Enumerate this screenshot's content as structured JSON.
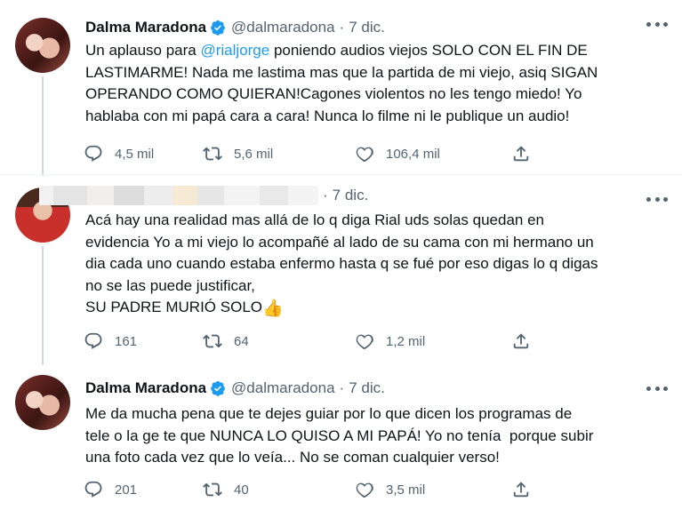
{
  "tweets": [
    {
      "name": "Dalma Maradona",
      "handle": "@dalmaradona",
      "sep": "·",
      "date": "7 dic.",
      "text_prefix": "Un aplauso para ",
      "mention": "@rialjorge",
      "text_rest": " poniendo audios viejos SOLO CON EL FIN DE\nLASTIMARME! Nada me lastima mas que la partida de mi viejo, asiq SIGAN\nOPERANDO COMO QUIERAN!Cagones violentos no les tengo miedo! Yo\nhablaba con mi papá cara a cara! Nunca lo filme ni le publique un audio!",
      "replies": "4,5 mil",
      "retweets": "5,6 mil",
      "likes": "106,4 mil"
    },
    {
      "sep": "·",
      "date": "7 dic.",
      "text": "Acá hay una realidad mas allá de lo q diga Rial uds solas quedan en\nevidencia Yo a mi viejo lo acompañé al lado de su cama con mi hermano un\ndia cada uno cuando estaba enfermo hasta q se fué por eso digas lo q digas\nno se las puede justificar,\nSU PADRE MURIÓ SOLO",
      "emoji": "👍",
      "replies": "161",
      "retweets": "64",
      "likes": "1,2 mil"
    },
    {
      "name": "Dalma Maradona",
      "handle": "@dalmaradona",
      "sep": "·",
      "date": "7 dic.",
      "text": "Me da mucha pena que te dejes guiar por lo que dicen los programas de\ntele o la ge te que NUNCA LO QUISO A MI PAPÁ! Yo no tenía  porque subir\nuna foto cada vez que lo veía... No se coman cualquier verso!",
      "replies": "201",
      "retweets": "40",
      "likes": "3,5 mil"
    }
  ],
  "colors": {
    "accent": "#1d9bf0",
    "muted": "#536471",
    "thread": "#cfd9de"
  },
  "icons": [
    "reply-icon",
    "retweet-icon",
    "like-icon",
    "share-icon",
    "verified-icon",
    "more-icon"
  ]
}
